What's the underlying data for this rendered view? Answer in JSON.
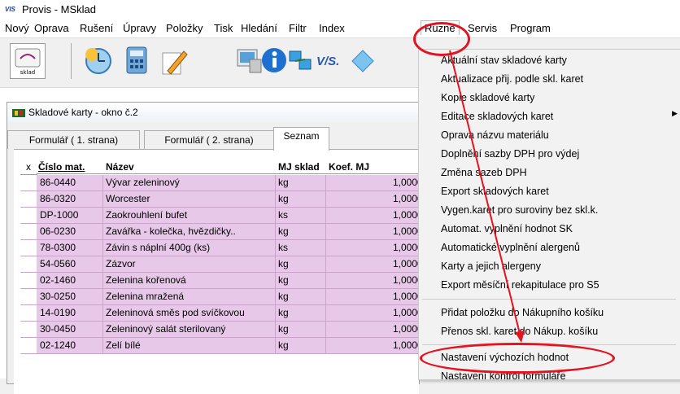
{
  "app": {
    "title": "Provis - MSklad",
    "icon_text": "VIS"
  },
  "menubar": {
    "items": [
      "Nový",
      "Oprava",
      "Rušení",
      "Úpravy",
      "Položky",
      "Tisk",
      "Hledání",
      "Filtr",
      "Index",
      "Ruzné",
      "Servis",
      "Program"
    ],
    "active_index": 9
  },
  "toolbar": {
    "buttons": [
      "sklad-icon",
      "clock-icon",
      "calculator-icon",
      "pencil-icon",
      "computer-icon",
      "info-icon",
      "network-icon",
      "vis-logo-icon",
      "diamond-icon"
    ],
    "vis_label": "V/S.",
    "sklad_label": "sklad"
  },
  "child_window": {
    "title": "Skladové karty - okno č.2",
    "tabs": [
      "Formulář ( 1. strana)",
      "Formulář ( 2. strana)",
      "Seznam"
    ],
    "active_tab": 2
  },
  "grid": {
    "columns": [
      "x",
      "Číslo mat.",
      "Název",
      "MJ sklad",
      "Koef. MJ"
    ],
    "rows": [
      [
        "86-0440",
        "Vývar zeleninový",
        "kg",
        "1,0000"
      ],
      [
        "86-0320",
        "Worcester",
        "kg",
        "1,0000"
      ],
      [
        "DP-1000",
        "Zaokrouhlení bufet",
        "ks",
        "1,0000"
      ],
      [
        "06-0230",
        "Zavářka - kolečka, hvězdičky..",
        "kg",
        "1,0000"
      ],
      [
        "78-0300",
        "Závin s náplní 400g (ks)",
        "ks",
        "1,0000"
      ],
      [
        "54-0560",
        "Zázvor",
        "kg",
        "1,0000"
      ],
      [
        "02-1460",
        "Zelenina kořenová",
        "kg",
        "1,0000"
      ],
      [
        "30-0250",
        "Zelenina mražená",
        "kg",
        "1,0000"
      ],
      [
        "14-0190",
        "Zeleninová směs pod svíčkovou",
        "kg",
        "1,0000"
      ],
      [
        "30-0450",
        "Zeleninový salát sterilovaný",
        "kg",
        "1,0000"
      ],
      [
        "02-1240",
        "Zelí bílé",
        "kg",
        "1,0000"
      ]
    ]
  },
  "dropdown": {
    "group1": [
      "Aktuální stav skladové karty",
      "Aktualizace přij. podle skl. karet",
      "Kopie skladové karty",
      "Editace skladových karet",
      "Oprava názvu materiálu",
      "Doplnění sazby DPH pro výdej",
      "Změna sazeb DPH",
      "Export skladových karet",
      "Vygen.karet pro suroviny bez skl.k.",
      "Automat. vyplnění hodnot SK",
      "Automatické vyplnění alergenů",
      "Karty a jejich alergeny",
      "Export měsíční rekapitulace pro S5"
    ],
    "group2": [
      "Přidat položku do Nákupního košíku",
      "Přenos skl. karet do Nákup. košíku"
    ],
    "group3": [
      "Nastavení výchozích hodnot",
      "Nastavení kontrol formuláře"
    ],
    "submenu_arrow": "▶"
  },
  "colors": {
    "grid_row": "#e8c8e8",
    "annotation": "#e5121f"
  }
}
